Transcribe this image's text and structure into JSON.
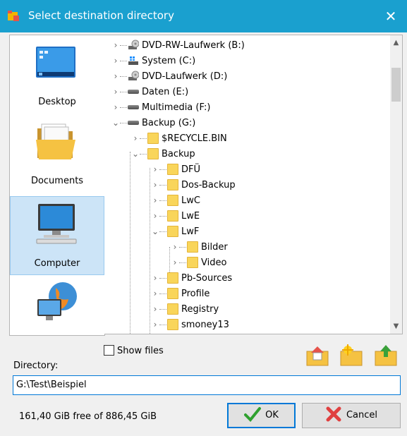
{
  "window": {
    "title": "Select destination directory",
    "close_glyph": "✕"
  },
  "places": [
    {
      "label": "Desktop",
      "icon": "desktop-icon"
    },
    {
      "label": "Documents",
      "icon": "documents-icon"
    },
    {
      "label": "Computer",
      "icon": "computer-icon",
      "selected": true
    },
    {
      "label": "",
      "icon": "network-icon"
    }
  ],
  "tree": [
    {
      "label": "DVD-RW-Laufwerk (B:)",
      "icon": "dvd-drive-icon",
      "expanded": false
    },
    {
      "label": "System (C:)",
      "icon": "system-drive-icon",
      "expanded": false
    },
    {
      "label": "DVD-Laufwerk (D:)",
      "icon": "dvd-drive-icon",
      "expanded": false
    },
    {
      "label": "Daten (E:)",
      "icon": "hard-drive-icon",
      "expanded": false
    },
    {
      "label": "Multimedia (F:)",
      "icon": "hard-drive-icon",
      "expanded": false
    },
    {
      "label": "Backup (G:)",
      "icon": "hard-drive-icon",
      "expanded": true
    },
    {
      "label": "$RECYCLE.BIN",
      "icon": "folder-icon",
      "expanded": false
    },
    {
      "label": "Backup",
      "icon": "folder-icon",
      "expanded": true
    },
    {
      "label": "DFÜ",
      "icon": "folder-icon",
      "expanded": false
    },
    {
      "label": "Dos-Backup",
      "icon": "folder-icon",
      "expanded": false
    },
    {
      "label": "LwC",
      "icon": "folder-icon",
      "expanded": false
    },
    {
      "label": "LwE",
      "icon": "folder-icon",
      "expanded": false
    },
    {
      "label": "LwF",
      "icon": "folder-icon",
      "expanded": true
    },
    {
      "label": "Bilder",
      "icon": "folder-icon",
      "expanded": false
    },
    {
      "label": "Video",
      "icon": "folder-icon",
      "expanded": false
    },
    {
      "label": "Pb-Sources",
      "icon": "folder-icon",
      "expanded": false
    },
    {
      "label": "Profile",
      "icon": "folder-icon",
      "expanded": false
    },
    {
      "label": "Registry",
      "icon": "folder-icon",
      "expanded": false
    },
    {
      "label": "smoney13",
      "icon": "folder-icon",
      "expanded": false
    }
  ],
  "show_files": {
    "label": "Show files",
    "checked": false
  },
  "toolbar": [
    "home-folder-icon",
    "new-folder-icon",
    "parent-folder-icon"
  ],
  "directory": {
    "label": "Directory:",
    "value": "G:\\Test\\Beispiel"
  },
  "status": {
    "free_space": "161,40 GiB free of 886,45 GiB"
  },
  "buttons": {
    "ok": "OK",
    "cancel": "Cancel"
  },
  "colors": {
    "titlebar": "#1aa0cf",
    "selection": "#cce4f7",
    "focus": "#0078d7"
  }
}
